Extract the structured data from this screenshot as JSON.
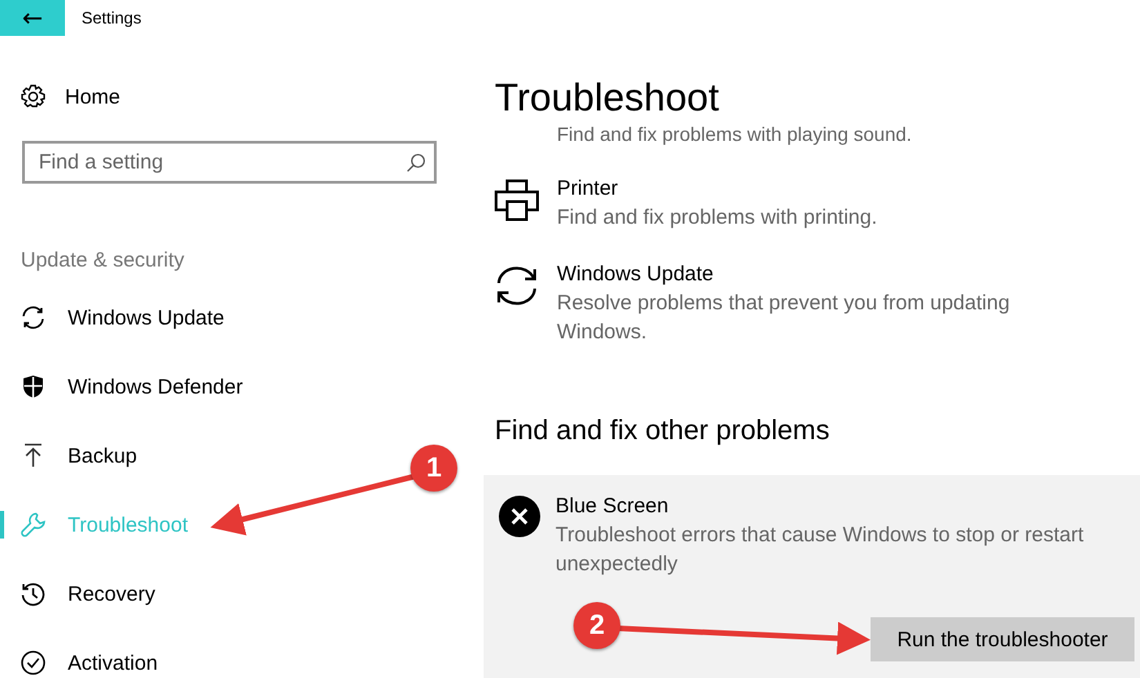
{
  "window": {
    "title": "Settings",
    "back_button": "←"
  },
  "sidebar": {
    "home": "Home",
    "search": {
      "placeholder": "Find a setting"
    },
    "section": "Update & security",
    "items": [
      {
        "label": "Windows Update",
        "selected": false
      },
      {
        "label": "Windows Defender",
        "selected": false
      },
      {
        "label": "Backup",
        "selected": false
      },
      {
        "label": "Troubleshoot",
        "selected": true
      },
      {
        "label": "Recovery",
        "selected": false
      },
      {
        "label": "Activation",
        "selected": false
      }
    ]
  },
  "page": {
    "title": "Troubleshoot",
    "cut_text": "Find and fix problems with playing sound.",
    "troubleshooters": [
      {
        "title": "Printer",
        "description": "Find and fix problems with printing."
      },
      {
        "title": "Windows Update",
        "description": "Resolve problems that prevent you from updating Windows."
      }
    ],
    "other_heading": "Find and fix other problems",
    "expanded_item": {
      "title": "Blue Screen",
      "description": "Troubleshoot errors that cause Windows to stop or restart unexpectedly",
      "button": "Run the troubleshooter"
    }
  },
  "annotations": [
    {
      "label": "1"
    },
    {
      "label": "2"
    }
  ]
}
